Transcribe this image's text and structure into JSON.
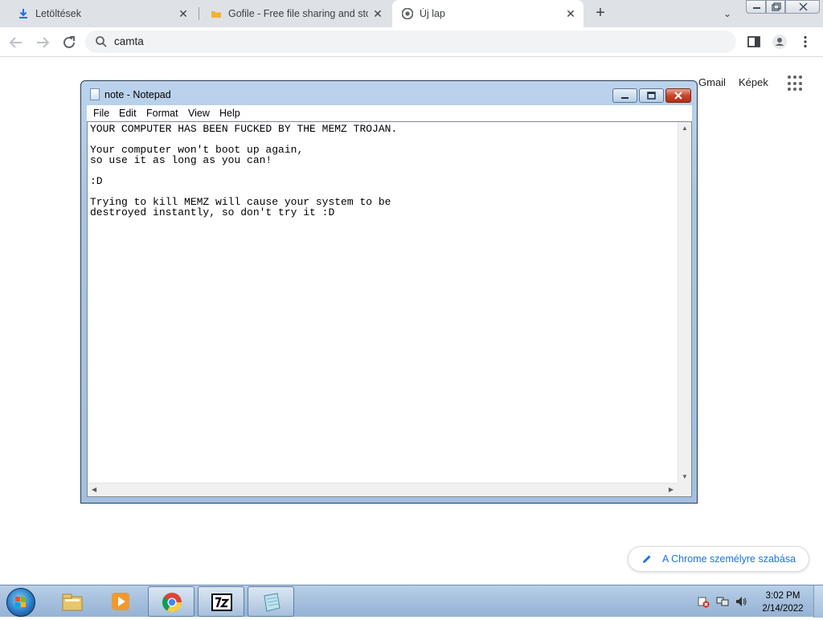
{
  "browser": {
    "tabs": [
      {
        "title": "Letöltések",
        "icon": "download-icon"
      },
      {
        "title": "Gofile - Free file sharing and stor",
        "icon": "folder-icon"
      },
      {
        "title": "Új lap",
        "icon": "chrome-icon",
        "active": true
      }
    ],
    "new_tab_label": "+",
    "address_bar": {
      "value": "camta"
    },
    "ntp": {
      "links": [
        "Gmail",
        "Képek"
      ],
      "customize_label": "A Chrome személyre szabása"
    }
  },
  "notepad": {
    "title": "note - Notepad",
    "menu": [
      "File",
      "Edit",
      "Format",
      "View",
      "Help"
    ],
    "content": "YOUR COMPUTER HAS BEEN FUCKED BY THE MEMZ TROJAN.\n\nYour computer won't boot up again,\nso use it as long as you can!\n\n:D\n\nTrying to kill MEMZ will cause your system to be\ndestroyed instantly, so don't try it :D"
  },
  "taskbar": {
    "apps": [
      "explorer-icon",
      "media-player-icon",
      "chrome-icon",
      "7zip-icon",
      "notepad-icon"
    ],
    "time": "3:02 PM",
    "date": "2/14/2022"
  },
  "colors": {
    "chrome_tabstrip": "#dee1e6",
    "chrome_accent": "#1a73e8",
    "notepad_frame": "#a9c4e3",
    "close_button": "#c9452a",
    "taskbar": "#a7c1de"
  }
}
